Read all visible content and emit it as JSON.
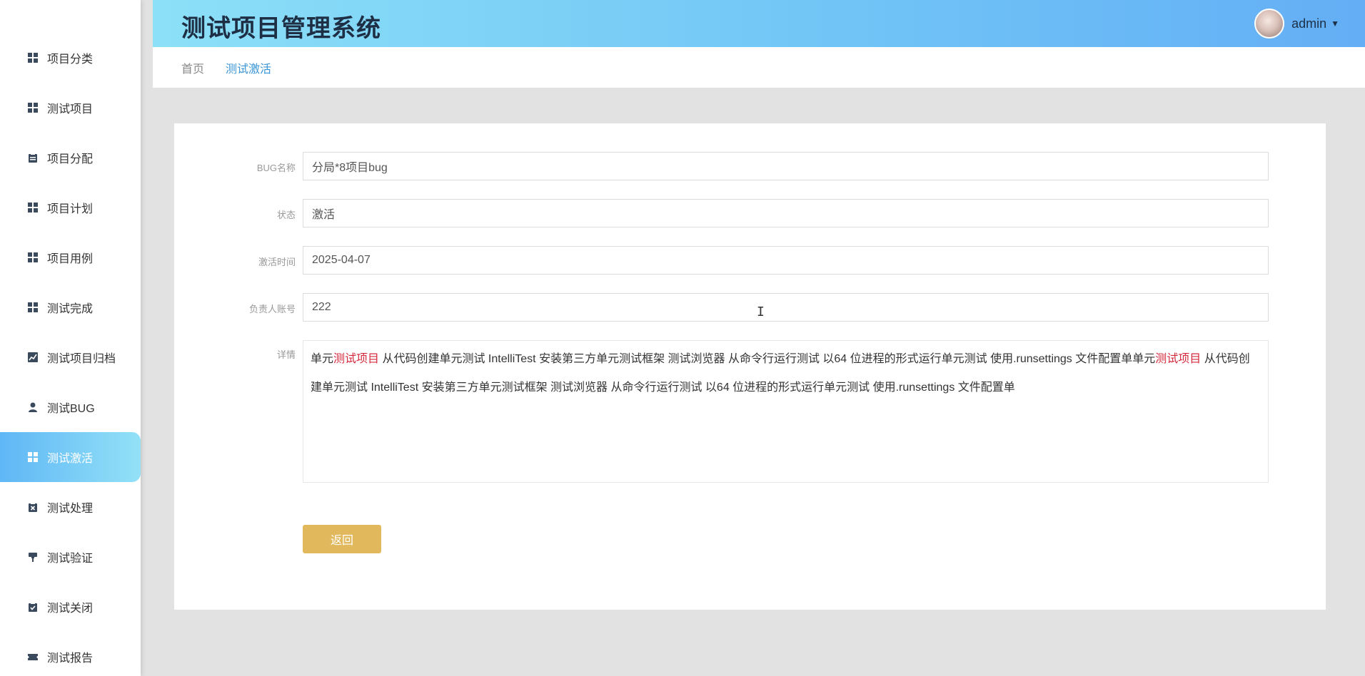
{
  "header": {
    "title": "测试项目管理系统",
    "user_name": "admin"
  },
  "sidebar": {
    "items": [
      {
        "label": "项目分类",
        "icon": "grid-icon"
      },
      {
        "label": "测试项目",
        "icon": "grid-icon"
      },
      {
        "label": "项目分配",
        "icon": "clipboard-icon"
      },
      {
        "label": "项目计划",
        "icon": "grid-icon"
      },
      {
        "label": "项目用例",
        "icon": "grid-icon"
      },
      {
        "label": "测试完成",
        "icon": "grid-icon"
      },
      {
        "label": "测试项目归档",
        "icon": "chart-icon"
      },
      {
        "label": "测试BUG",
        "icon": "user-icon"
      },
      {
        "label": "测试激活",
        "icon": "grid-icon",
        "active": true
      },
      {
        "label": "测试处理",
        "icon": "clipboard-x-icon"
      },
      {
        "label": "测试验证",
        "icon": "brush-icon"
      },
      {
        "label": "测试关闭",
        "icon": "clipboard-check-icon"
      },
      {
        "label": "测试报告",
        "icon": "ticket-icon"
      }
    ]
  },
  "breadcrumb": {
    "home": "首页",
    "current": "测试激活"
  },
  "form": {
    "bug_name_label": "BUG名称",
    "bug_name_value": "分局*8项目bug",
    "status_label": "状态",
    "status_value": "激活",
    "activation_time_label": "激活时间",
    "activation_time_value": "2025-04-07",
    "owner_account_label": "负责人账号",
    "owner_account_value": "222",
    "details_label": "详情",
    "details_segments": [
      {
        "text": "单元",
        "highlight": false
      },
      {
        "text": "测试项目",
        "highlight": true
      },
      {
        "text": " 从代码创建单元测试 IntelliTest 安装第三方单元测试框架 测试浏览器 从命令行运行测试 以64 位进程的形式运行单元测试 使用.runsettings 文件配置单单元",
        "highlight": false
      },
      {
        "text": "测试项目",
        "highlight": true
      },
      {
        "text": " 从代码创建单元测试 IntelliTest 安装第三方单元测试框架 测试浏览器 从命令行运行测试 以64 位进程的形式运行单元测试 使用.runsettings 文件配置单",
        "highlight": false
      }
    ],
    "back_label": "返回"
  },
  "colors": {
    "accent": "#5fb7f5",
    "highlight": "#d4283c",
    "back_button": "#e1b95c"
  }
}
